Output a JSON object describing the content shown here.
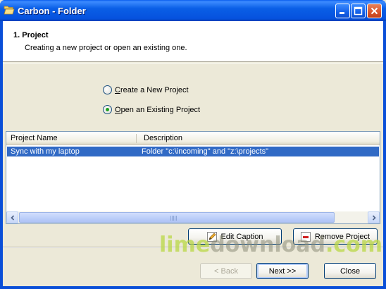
{
  "window": {
    "title": "Carbon - Folder",
    "icon": "folder-open-icon"
  },
  "header": {
    "step_title": "1. Project",
    "step_description": "Creating a new project or open an existing one."
  },
  "options": {
    "create_new": {
      "label_accel": "C",
      "label_rest": "reate a New Project",
      "selected": false
    },
    "open_existing": {
      "label_accel": "O",
      "label_rest": "pen an Existing Project",
      "selected": true
    }
  },
  "projects_list": {
    "columns": [
      "Project Name",
      "Description"
    ],
    "rows": [
      {
        "name": "Sync with my laptop",
        "description": "Folder \"c:\\incoming\" and \"z:\\projects\"",
        "selected": true
      }
    ]
  },
  "list_buttons": {
    "edit_caption": "Edit Caption",
    "remove_project": "Remove Project"
  },
  "nav_buttons": {
    "back": "< Back",
    "next": "Next >>",
    "close": "Close"
  },
  "watermark": {
    "part1": "lime",
    "part2": "download",
    "part3": ".com"
  },
  "colors": {
    "titlebar": "#0a5fe6",
    "selection": "#316ac5",
    "dialog_bg": "#ece9d8"
  }
}
